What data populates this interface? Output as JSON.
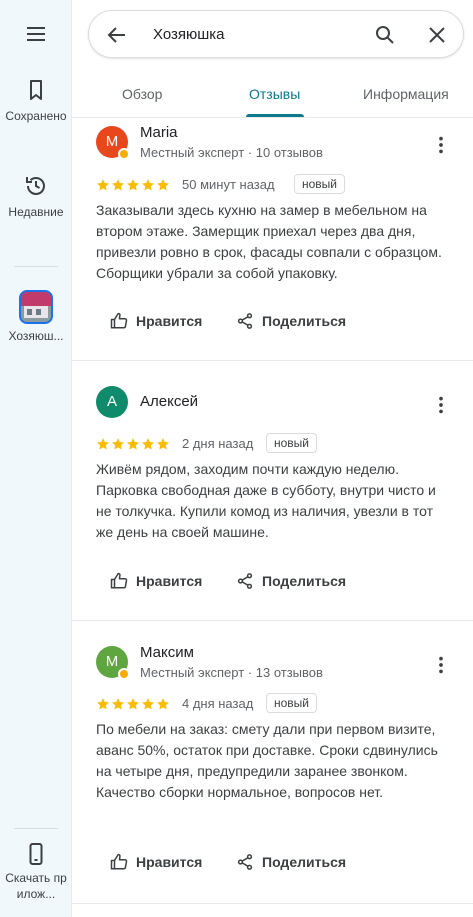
{
  "rail": {
    "menu_icon": "menu-icon",
    "items": [
      {
        "label": "Сохранено",
        "icon": "bookmark-icon"
      },
      {
        "label": "Недавние",
        "icon": "history-icon"
      },
      {
        "label": "Хозяюш...",
        "icon": "place-thumbnail"
      },
      {
        "label": "Скачать прилож...",
        "icon": "phone-icon"
      }
    ]
  },
  "search": {
    "query": "Хозяюшка",
    "back_icon": "arrow-back-icon",
    "search_icon": "search-icon",
    "clear_icon": "close-icon"
  },
  "tabs": [
    {
      "label": "Обзор",
      "active": false
    },
    {
      "label": "Отзывы",
      "active": true
    },
    {
      "label": "Информация",
      "active": false
    }
  ],
  "colors": {
    "accent": "#0b7a8a",
    "star": "#fbbc04",
    "avatar_maria": "#e8471c",
    "avatar_aleksey": "#0f8b6c",
    "avatar_maksim": "#5fa641"
  },
  "reviews": [
    {
      "initial": "M",
      "name": "Maria",
      "meta": "Местный эксперт · 10 отзывов",
      "rating": 5,
      "time": "50 минут назад",
      "tag": "новый",
      "text": "Заказывали здесь кухню на замер в мебельном на втором этаже. Замерщик приехал через два дня, привезли ровно в срок, фасады совпали с образцом. Сборщики убрали за собой упаковку.",
      "like": "Нравится",
      "share": "Поделиться"
    },
    {
      "initial": "А",
      "name": "Алексей",
      "meta": "",
      "rating": 5,
      "time": "2 дня назад",
      "tag": "новый",
      "text": "Живём рядом, заходим почти каждую неделю. Парковка свободная даже в субботу, внутри чисто и не толкучка. Купили комод из наличия, увезли в тот же день на своей машине.",
      "like": "Нравится",
      "share": "Поделиться"
    },
    {
      "initial": "M",
      "name": "Максим",
      "meta": "Местный эксперт · 13 отзывов",
      "rating": 5,
      "time": "4 дня назад",
      "tag": "новый",
      "text": "По мебели на заказ: смету дали при первом визите, аванс 50%, остаток при доставке. Сроки сдвинулись на четыре дня, предупредили заранее звонком. Качество сборки нормальное, вопросов нет.",
      "like": "Нравится",
      "share": "Поделиться"
    }
  ]
}
